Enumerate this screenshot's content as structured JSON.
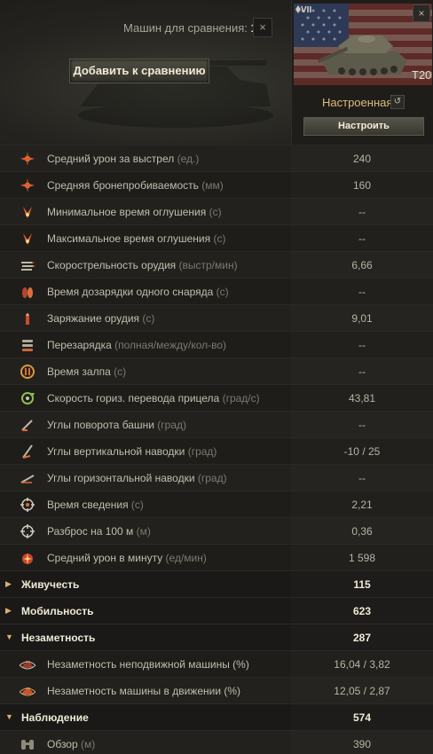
{
  "header": {
    "compare_label": "Машин для сравнения:",
    "compare_count": "1",
    "close_glyph": "×",
    "add_button": "Добавить к сравнению"
  },
  "tank": {
    "tier": "VII",
    "name": "T20",
    "state": "Настроенная",
    "reset_glyph": "↺",
    "configure_button": "Настроить",
    "close_glyph": "×"
  },
  "rows": [
    {
      "type": "stat",
      "icon": "burst-icon",
      "label": "Средний урон за выстрел",
      "unit": "(ед.)",
      "value": "240"
    },
    {
      "type": "stat",
      "icon": "burst-icon",
      "label": "Средняя бронепробиваемость",
      "unit": "(мм)",
      "value": "160"
    },
    {
      "type": "stat",
      "icon": "stun-icon",
      "label": "Минимальное время оглушения",
      "unit": "(с)",
      "value": "--"
    },
    {
      "type": "stat",
      "icon": "stun-icon",
      "label": "Максимальное время оглушения",
      "unit": "(с)",
      "value": "--"
    },
    {
      "type": "stat",
      "icon": "fire-rate-icon",
      "label": "Скорострельность орудия",
      "unit": "(выстр/мин)",
      "value": "6,66"
    },
    {
      "type": "stat",
      "icon": "shell-reload-icon",
      "label": "Время дозарядки одного снаряда",
      "unit": "(с)",
      "value": "--"
    },
    {
      "type": "stat",
      "icon": "shell-icon",
      "label": "Заряжание орудия",
      "unit": "(с)",
      "value": "9,01"
    },
    {
      "type": "stat",
      "icon": "clip-reload-icon",
      "label": "Перезарядка",
      "unit": "(полная/между/кол-во)",
      "value": "--"
    },
    {
      "type": "stat",
      "icon": "salvo-icon",
      "label": "Время залпа",
      "unit": "(с)",
      "value": "--"
    },
    {
      "type": "stat",
      "icon": "traverse-icon",
      "label": "Скорость гориз. перевода прицела",
      "unit": "(град/с)",
      "value": "43,81"
    },
    {
      "type": "stat",
      "icon": "turret-angle-icon",
      "label": "Углы поворота башни",
      "unit": "(град)",
      "value": "--"
    },
    {
      "type": "stat",
      "icon": "elevation-icon",
      "label": "Углы вертикальной наводки",
      "unit": "(град)",
      "value": "-10 / 25"
    },
    {
      "type": "stat",
      "icon": "horizontal-angle-icon",
      "label": "Углы горизонтальной наводки",
      "unit": "(град)",
      "value": "--"
    },
    {
      "type": "stat",
      "icon": "aim-time-icon",
      "label": "Время сведения",
      "unit": "(с)",
      "value": "2,21"
    },
    {
      "type": "stat",
      "icon": "crosshair-icon",
      "label": "Разброс на 100 м",
      "unit": "(м)",
      "value": "0,36"
    },
    {
      "type": "stat",
      "icon": "dpm-icon",
      "label": "Средний урон в минуту",
      "unit": "(ед/мин)",
      "value": "1 598"
    },
    {
      "type": "section",
      "expanded": false,
      "label": "Живучесть",
      "value": "115"
    },
    {
      "type": "section",
      "expanded": false,
      "label": "Мобильность",
      "value": "623"
    },
    {
      "type": "section",
      "expanded": true,
      "label": "Незаметность",
      "value": "287"
    },
    {
      "type": "stat",
      "icon": "camo-stationary-icon",
      "label": "Незаметность неподвижной машины (%)",
      "unit": "",
      "value": "16,04 / 3,82"
    },
    {
      "type": "stat",
      "icon": "camo-moving-icon",
      "label": "Незаметность машины в движении (%)",
      "unit": "",
      "value": "12,05 / 2,87"
    },
    {
      "type": "section",
      "expanded": true,
      "label": "Наблюдение",
      "value": "574"
    },
    {
      "type": "stat",
      "icon": "binoculars-icon",
      "label": "Обзор",
      "unit": "(м)",
      "value": "390"
    }
  ],
  "colors": {
    "accent_gold": "#d9b26a",
    "background": "#1b1a17"
  }
}
